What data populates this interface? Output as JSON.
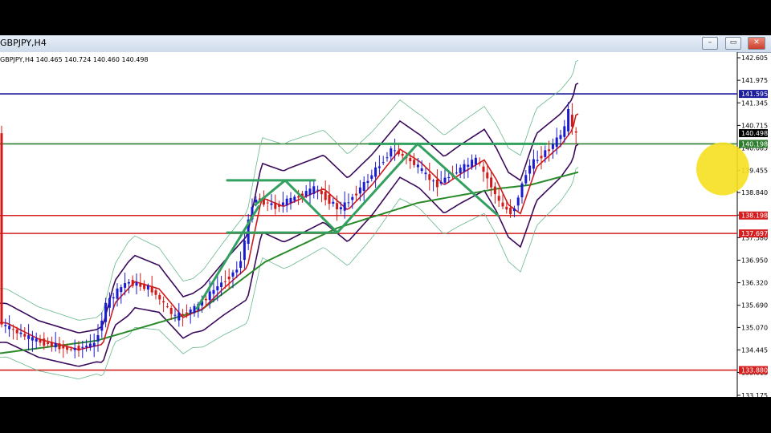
{
  "window": {
    "title": "GBPJPY,H4",
    "buttons": {
      "minimize": "–",
      "restore": "▭",
      "close": "✕"
    }
  },
  "chart_data": {
    "type": "candlestick",
    "symbol": "GBPJPY",
    "timeframe": "H4",
    "info": "GBPJPY,H4  140.465 140.724 140.460 140.498",
    "ohlc_last": {
      "open": 140.465,
      "high": 140.724,
      "low": 140.46,
      "close": 140.498
    },
    "ylim": [
      133.175,
      142.605
    ],
    "y_ticks": [
      "142.605",
      "141.975",
      "141.345",
      "140.715",
      "140.085",
      "139.455",
      "138.840",
      "138.210",
      "137.580",
      "136.950",
      "136.320",
      "135.690",
      "135.070",
      "134.445",
      "133.815",
      "133.175"
    ],
    "price_tags": [
      {
        "label": "141.595",
        "value": 141.595,
        "color": "#1c1c9c"
      },
      {
        "label": "140.498",
        "value": 140.498,
        "color": "#000000"
      },
      {
        "label": "140.198",
        "value": 140.198,
        "color": "#2e7d2e"
      },
      {
        "label": "138.198",
        "value": 138.198,
        "color": "#d42020"
      },
      {
        "label": "137.697",
        "value": 137.697,
        "color": "#d42020"
      },
      {
        "label": "133.880",
        "value": 133.88,
        "color": "#d42020"
      }
    ],
    "colors": {
      "bull": "#1a1ad0",
      "bear": "#d01a1a",
      "ma_fast": "#d01a1a",
      "ma_slow": "#2a8a2a",
      "band_inner": "#3a0a5a",
      "band_outer": "#66b88a",
      "pattern": "#33a060",
      "highlight": "#f5e020"
    }
  }
}
